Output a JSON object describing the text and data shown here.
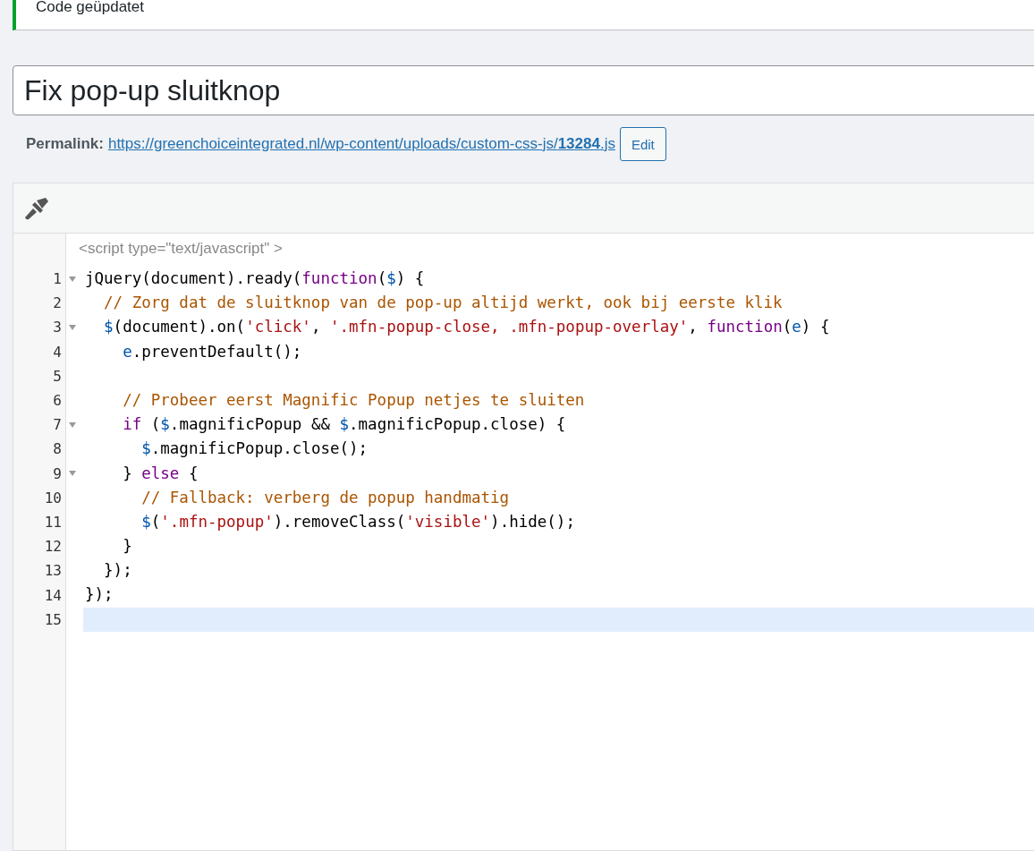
{
  "notice": {
    "text": "Code geüpdatet"
  },
  "title_field": {
    "value": "Fix pop-up sluitknop"
  },
  "permalink": {
    "label": "Permalink:",
    "url": "https://greenchoiceintegrated.nl/wp-content/uploads/custom-css-js/**13284**.js",
    "button": "Edit"
  },
  "editor": {
    "script_tag": "<script type=\"text/javascript\" >",
    "lines": [
      {
        "number": "1",
        "foldable": true,
        "active": false,
        "tokens": [
          {
            "kind": "plain",
            "text": "jQuery(document).ready("
          },
          {
            "kind": "keyword",
            "text": "function"
          },
          {
            "kind": "plain",
            "text": "("
          },
          {
            "kind": "variable",
            "text": "$"
          },
          {
            "kind": "plain",
            "text": ") {"
          }
        ]
      },
      {
        "number": "2",
        "foldable": false,
        "active": false,
        "tokens": [
          {
            "kind": "comment",
            "text": "  // Zorg dat de sluitknop van de pop-up altijd werkt, ook bij eerste klik"
          }
        ]
      },
      {
        "number": "3",
        "foldable": true,
        "active": false,
        "tokens": [
          {
            "kind": "variable",
            "text": "  $"
          },
          {
            "kind": "plain",
            "text": "(document).on("
          },
          {
            "kind": "string",
            "text": "'click'"
          },
          {
            "kind": "plain",
            "text": ", "
          },
          {
            "kind": "string",
            "text": "'.mfn-popup-close, .mfn-popup-overlay'"
          },
          {
            "kind": "plain",
            "text": ", "
          },
          {
            "kind": "keyword",
            "text": "function"
          },
          {
            "kind": "plain",
            "text": "("
          },
          {
            "kind": "variable",
            "text": "e"
          },
          {
            "kind": "plain",
            "text": ") {"
          }
        ]
      },
      {
        "number": "4",
        "foldable": false,
        "active": false,
        "tokens": [
          {
            "kind": "variable",
            "text": "    e"
          },
          {
            "kind": "plain",
            "text": ".preventDefault();"
          }
        ]
      },
      {
        "number": "5",
        "foldable": false,
        "active": false
      },
      {
        "number": "6",
        "foldable": false,
        "active": false,
        "tokens": [
          {
            "kind": "comment",
            "text": "    // Probeer eerst Magnific Popup netjes te sluiten"
          }
        ]
      },
      {
        "number": "7",
        "foldable": true,
        "active": false,
        "tokens": [
          {
            "kind": "keyword",
            "text": "    if"
          },
          {
            "kind": "plain",
            "text": " ("
          },
          {
            "kind": "variable",
            "text": "$"
          },
          {
            "kind": "plain",
            "text": ".magnificPopup && "
          },
          {
            "kind": "variable",
            "text": "$"
          },
          {
            "kind": "plain",
            "text": ".magnificPopup.close) {"
          }
        ]
      },
      {
        "number": "8",
        "foldable": false,
        "active": false,
        "tokens": [
          {
            "kind": "variable",
            "text": "      $"
          },
          {
            "kind": "plain",
            "text": ".magnificPopup.close();"
          }
        ]
      },
      {
        "number": "9",
        "foldable": true,
        "active": false,
        "tokens": [
          {
            "kind": "plain",
            "text": "    } "
          },
          {
            "kind": "keyword",
            "text": "else"
          },
          {
            "kind": "plain",
            "text": " {"
          }
        ]
      },
      {
        "number": "10",
        "foldable": false,
        "active": false,
        "tokens": [
          {
            "kind": "comment",
            "text": "      // Fallback: verberg de popup handmatig"
          }
        ]
      },
      {
        "number": "11",
        "foldable": false,
        "active": false,
        "tokens": [
          {
            "kind": "variable",
            "text": "      $"
          },
          {
            "kind": "plain",
            "text": "("
          },
          {
            "kind": "string",
            "text": "'.mfn-popup'"
          },
          {
            "kind": "plain",
            "text": ").removeClass("
          },
          {
            "kind": "string",
            "text": "'visible'"
          },
          {
            "kind": "plain",
            "text": ").hide();"
          }
        ]
      },
      {
        "number": "12",
        "foldable": false,
        "active": false,
        "tokens": [
          {
            "kind": "plain",
            "text": "    }"
          }
        ]
      },
      {
        "number": "13",
        "foldable": false,
        "active": false,
        "tokens": [
          {
            "kind": "plain",
            "text": "  });"
          }
        ]
      },
      {
        "number": "14",
        "foldable": false,
        "active": false,
        "tokens": [
          {
            "kind": "plain",
            "text": "});"
          }
        ]
      },
      {
        "number": "15",
        "foldable": false,
        "active": true
      }
    ]
  }
}
